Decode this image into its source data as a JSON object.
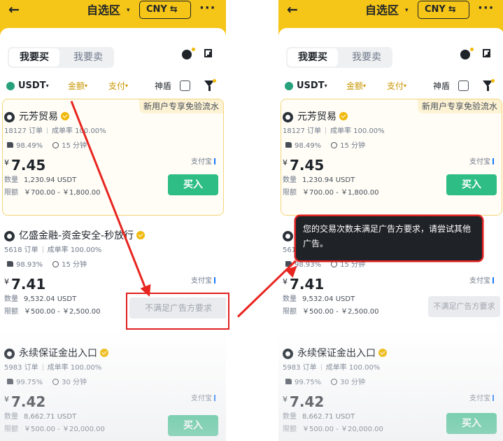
{
  "header": {
    "back_icon": "←",
    "title": "自选区",
    "caret": "▾",
    "currency": "CNY",
    "swap_icon": "⇆",
    "more": "···"
  },
  "tabs": {
    "buy": "我要买",
    "sell": "我要卖"
  },
  "filters": {
    "coin": "USDT",
    "amount": "金额",
    "payment": "支付",
    "shield": "神盾",
    "caret": "▾"
  },
  "promo_badge": "新用户专享免验流水",
  "offers": [
    {
      "merchant": "元芳贸易",
      "orders": "18127 订单",
      "completion": "成单率 100.00%",
      "positive": "98.49%",
      "time": "15 分钟",
      "currency_symbol": "¥",
      "price": "7.45",
      "payment": "支付宝",
      "qty_label": "数量",
      "qty": "1,230.94 USDT",
      "limit_label": "限额",
      "limit": "￥700.00 - ￥1,800.00",
      "action": "买入"
    },
    {
      "merchant": "亿盛金融-资金安全-秒放行",
      "orders": "5618 订单",
      "completion": "成单率 100.00%",
      "positive": "98.93%",
      "time": "15 分钟",
      "currency_symbol": "¥",
      "price": "7.41",
      "payment": "支付宝",
      "qty_label": "数量",
      "qty": "9,532.04 USDT",
      "limit_label": "限额",
      "limit": "￥500.00 - ￥2,500.00",
      "action": "不满足广告方要求"
    },
    {
      "merchant": "永续保证金出入口",
      "orders": "5983 订单",
      "completion": "成单率 100.00%",
      "positive": "99.75%",
      "time": "30 分钟",
      "currency_symbol": "¥",
      "price": "7.42",
      "payment": "支付宝",
      "qty_label": "数量",
      "qty": "8,662.71 USDT",
      "limit_label": "限额",
      "limit": "￥500.00 - ￥20,000.00",
      "action": "买入"
    }
  ],
  "right_panel": {
    "second_merchant_visible": "亿",
    "second_orders_visible": "561",
    "tooltip": "您的交易次数未满足广告方要求，请尝试其他广告。"
  },
  "annotations": {
    "highlight_color": "#e02020",
    "arrow_color": "#e8241f"
  },
  "colors": {
    "brand_yellow": "#f5c518",
    "buy_green": "#2ebd85",
    "gold_text": "#c99400"
  }
}
